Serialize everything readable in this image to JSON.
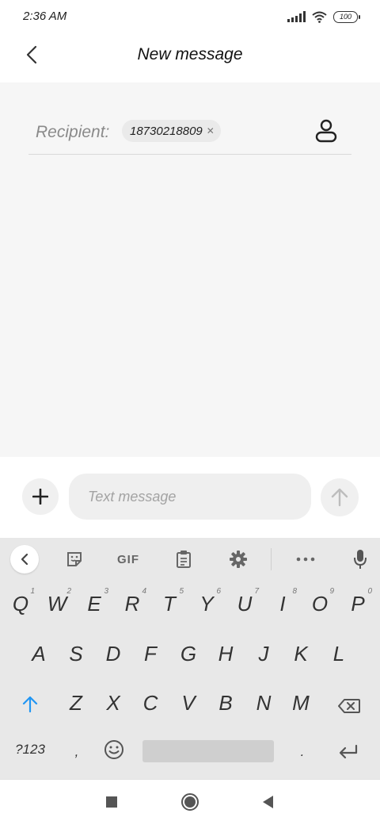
{
  "status_bar": {
    "time": "2:36 AM",
    "battery": "100",
    "icons": [
      "signal-icon",
      "wifi-icon",
      "battery-icon"
    ]
  },
  "header": {
    "title": "New message",
    "back_icon": "chevron-left-icon"
  },
  "recipient": {
    "label": "Recipient:",
    "chip_value": "18730218809",
    "chip_remove_icon": "close-icon",
    "contact_icon": "person-icon"
  },
  "composer": {
    "attach_icon": "plus-icon",
    "placeholder": "Text message",
    "value": "",
    "send_icon": "arrow-up-icon"
  },
  "keyboard_toolbar": {
    "items": [
      "chevron-left-icon",
      "sticker-icon",
      "GIF",
      "clipboard-icon",
      "gear-icon",
      "more-icon",
      "microphone-icon"
    ]
  },
  "keyboard": {
    "row1": [
      "Q",
      "W",
      "E",
      "R",
      "T",
      "Y",
      "U",
      "I",
      "O",
      "P"
    ],
    "row1_hints": [
      "1",
      "2",
      "3",
      "4",
      "5",
      "6",
      "7",
      "8",
      "9",
      "0"
    ],
    "row2": [
      "A",
      "S",
      "D",
      "F",
      "G",
      "H",
      "J",
      "K",
      "L"
    ],
    "row3": [
      "Z",
      "X",
      "C",
      "V",
      "B",
      "N",
      "M"
    ],
    "symbols_key": "?123",
    "comma": ",",
    "period": ".",
    "shift_icon": "shift-icon",
    "backspace_icon": "backspace-icon",
    "emoji_icon": "emoji-icon",
    "enter_icon": "enter-icon"
  },
  "nav_bar": {
    "items": [
      "recents-icon",
      "home-icon",
      "back-icon"
    ]
  },
  "colors": {
    "accent": "#2196f3",
    "background": "#f7f7f7",
    "keyboard": "#e8e8e8"
  }
}
